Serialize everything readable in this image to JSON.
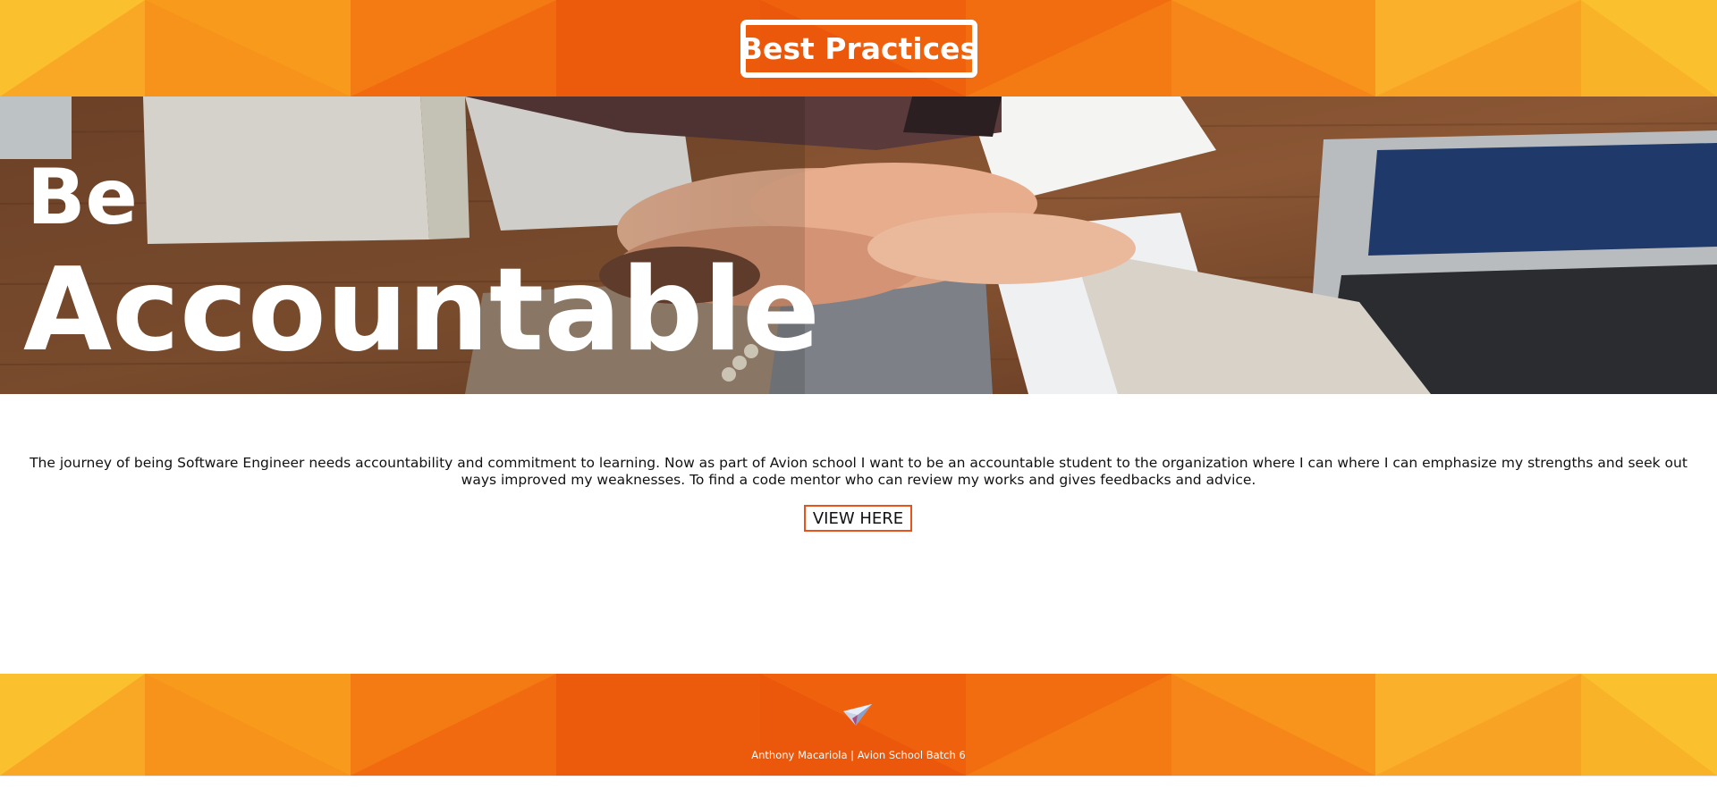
{
  "header": {
    "title": "Best Practices"
  },
  "hero": {
    "line1": "Be",
    "line2": "Accountable"
  },
  "content": {
    "paragraph": "The journey of being Software Engineer needs accountability and commitment to learning. Now as part of Avion school I want to be an accountable student to the organization where I can where I can emphasize my strengths and seek out ways improved my weaknesses. To find a code mentor who can review my works and gives feedbacks and advice.",
    "button_label": "VIEW HERE"
  },
  "footer": {
    "credit": "Anthony Macariola | Avion School Batch 6",
    "icon": "paper-plane-icon"
  },
  "colors": {
    "accent": "#e8531b",
    "band_yellow": "#fbc02d",
    "band_orange": "#f57c00",
    "band_deep": "#e65100"
  }
}
